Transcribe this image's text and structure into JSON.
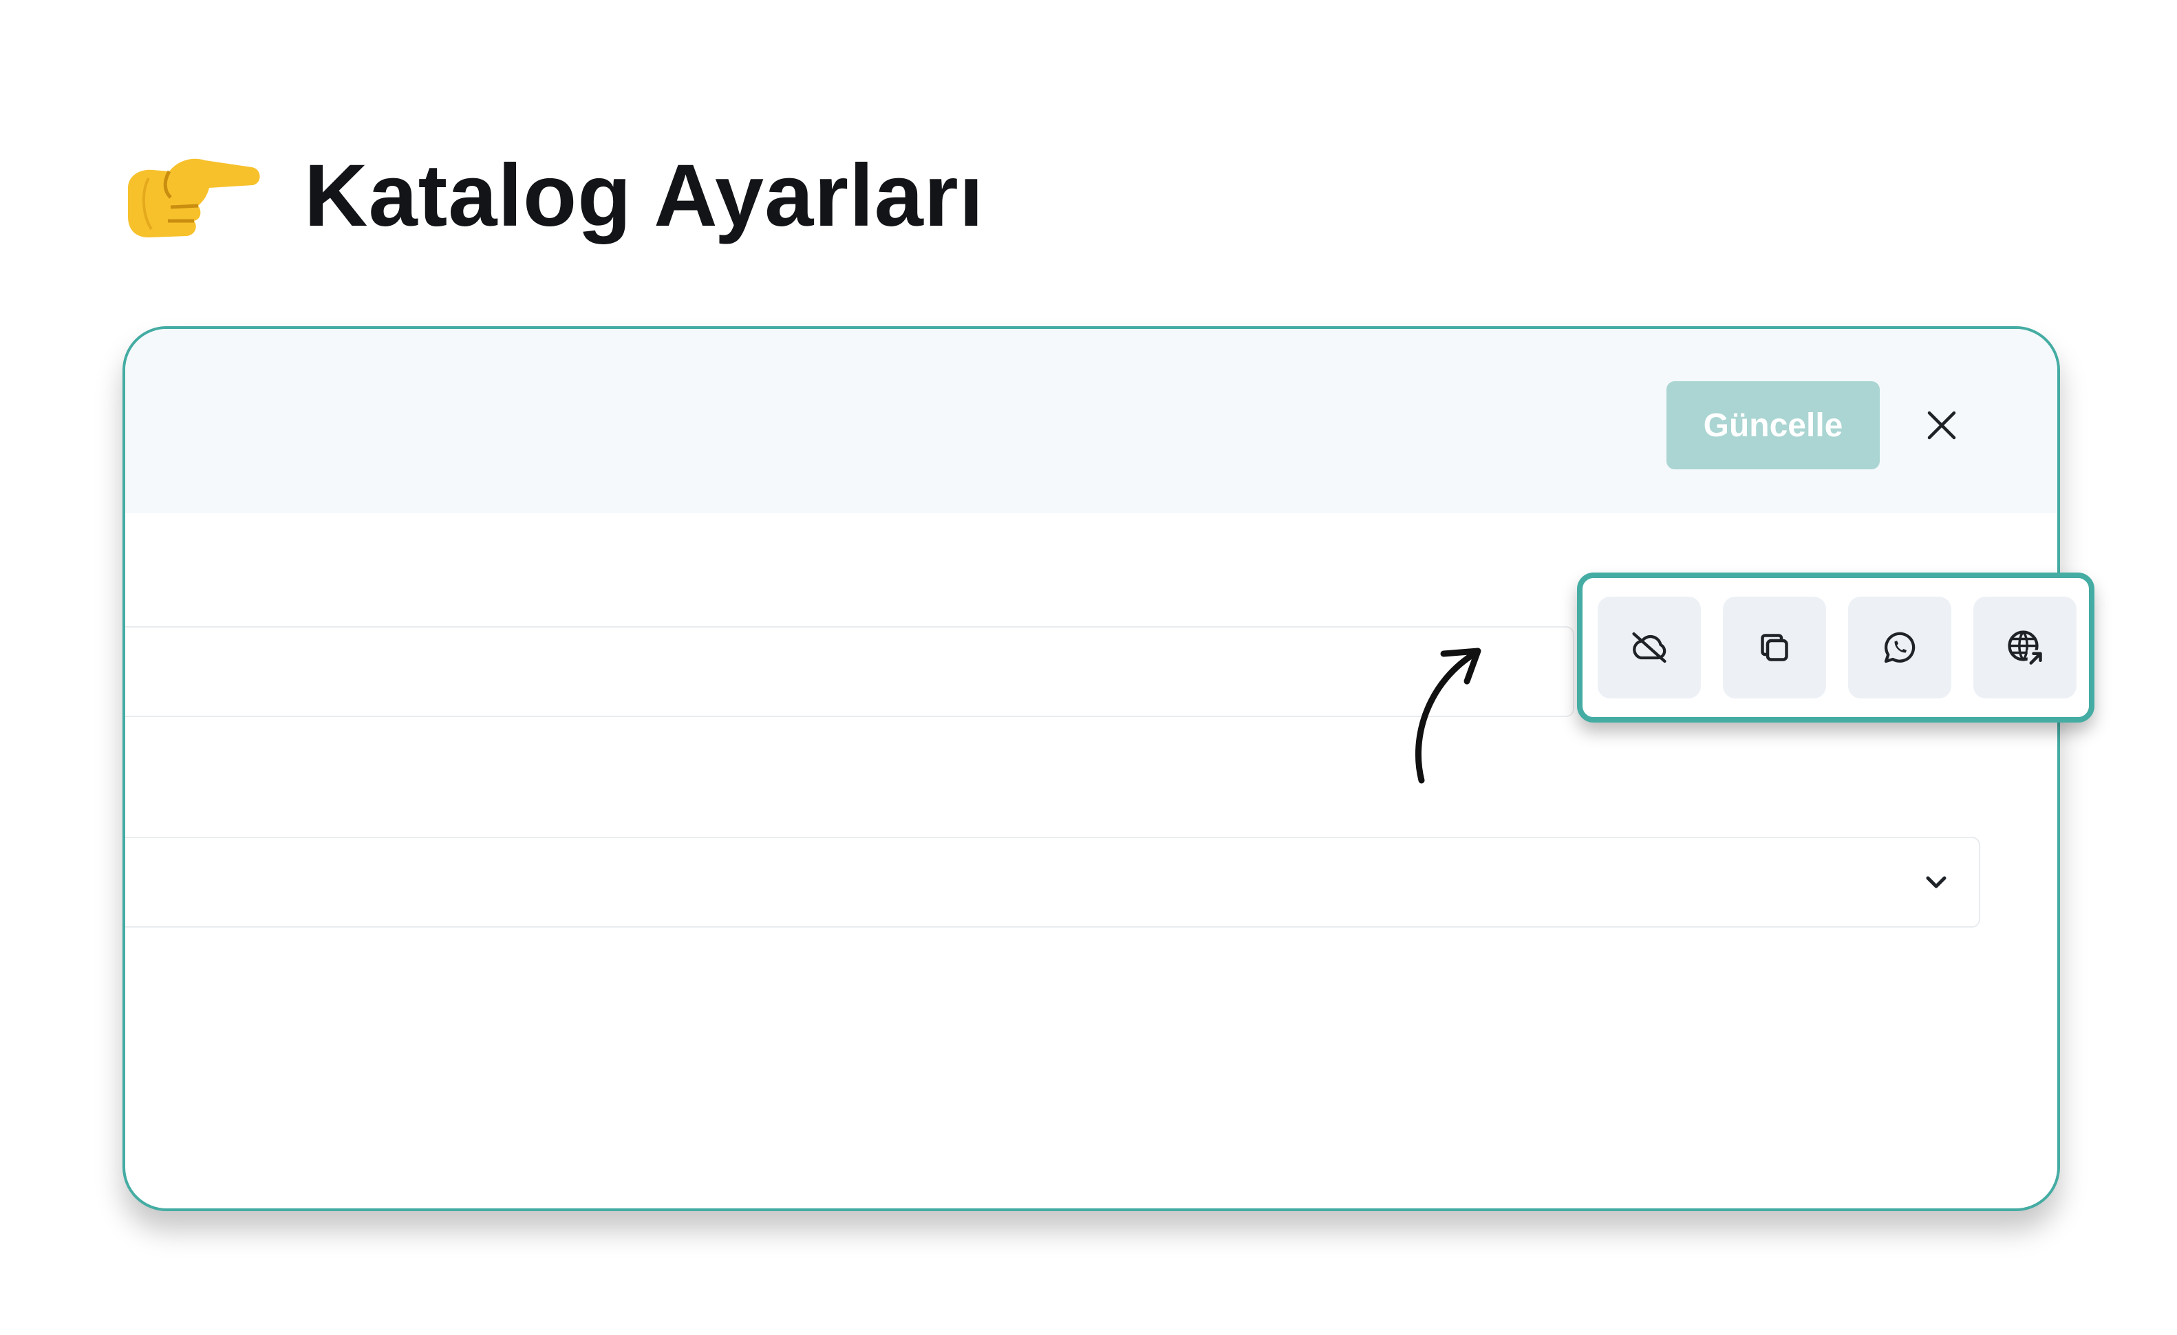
{
  "heading": {
    "title": "Katalog Ayarları",
    "icon": "pointing-hand-icon"
  },
  "panel": {
    "update_button_label": "Güncelle",
    "close_icon": "close-icon",
    "input_value": "",
    "select_value": "",
    "select_icon": "chevron-down-icon"
  },
  "toolbar": {
    "buttons": [
      {
        "icon": "cloud-off-icon"
      },
      {
        "icon": "copy-icon"
      },
      {
        "icon": "whatsapp-icon"
      },
      {
        "icon": "globe-external-icon"
      }
    ]
  },
  "colors": {
    "accent": "#44aca3",
    "button_disabled": "#aad5d2",
    "header_bg": "#f5f9fb",
    "tool_bg": "#edf1f5",
    "text": "#121417"
  }
}
